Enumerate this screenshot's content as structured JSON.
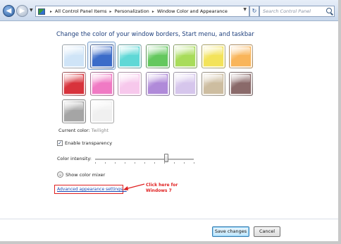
{
  "address_bar": {
    "crumbs": [
      "All Control Panel Items",
      "Personalization",
      "Window Color and Appearance"
    ],
    "search_placeholder": "Search Control Panel"
  },
  "heading": "Change the color of your window borders, Start menu, and taskbar",
  "swatches": [
    {
      "name": "sky",
      "color": "#cfe4f7",
      "selected": false
    },
    {
      "name": "twilight",
      "color": "#3c6cc9",
      "selected": true
    },
    {
      "name": "sea",
      "color": "#5fd8d6",
      "selected": false
    },
    {
      "name": "leaf",
      "color": "#64c85e",
      "selected": false
    },
    {
      "name": "lime",
      "color": "#a8dc5a",
      "selected": false
    },
    {
      "name": "lemon",
      "color": "#f3e35a",
      "selected": false
    },
    {
      "name": "orange",
      "color": "#f9b55a",
      "selected": false
    },
    {
      "name": "ruby",
      "color": "#d8333c",
      "selected": false
    },
    {
      "name": "fuchsia",
      "color": "#f07ac4",
      "selected": false
    },
    {
      "name": "blush",
      "color": "#f7c8ec",
      "selected": false
    },
    {
      "name": "violet",
      "color": "#b08ad9",
      "selected": false
    },
    {
      "name": "lavender",
      "color": "#d6c6ec",
      "selected": false
    },
    {
      "name": "taupe",
      "color": "#cdbda0",
      "selected": false
    },
    {
      "name": "chocolate",
      "color": "#8a6a6a",
      "selected": false
    },
    {
      "name": "slate",
      "color": "#a5a5a5",
      "selected": false
    },
    {
      "name": "frost",
      "color": "#f0f0f0",
      "selected": false
    }
  ],
  "current_color": {
    "label": "Current color:",
    "value": "Twilight"
  },
  "transparency": {
    "label": "Enable transparency",
    "checked": true
  },
  "intensity": {
    "label": "Color intensity:",
    "value_fraction": 0.72
  },
  "mixer": {
    "label": "Show color mixer"
  },
  "advanced_link": "Advanced appearance settings...",
  "annotation": {
    "line1": "Click here for",
    "line2": "Windows 7",
    "color": "#e02020"
  },
  "buttons": {
    "save": "Save changes",
    "cancel": "Cancel"
  }
}
